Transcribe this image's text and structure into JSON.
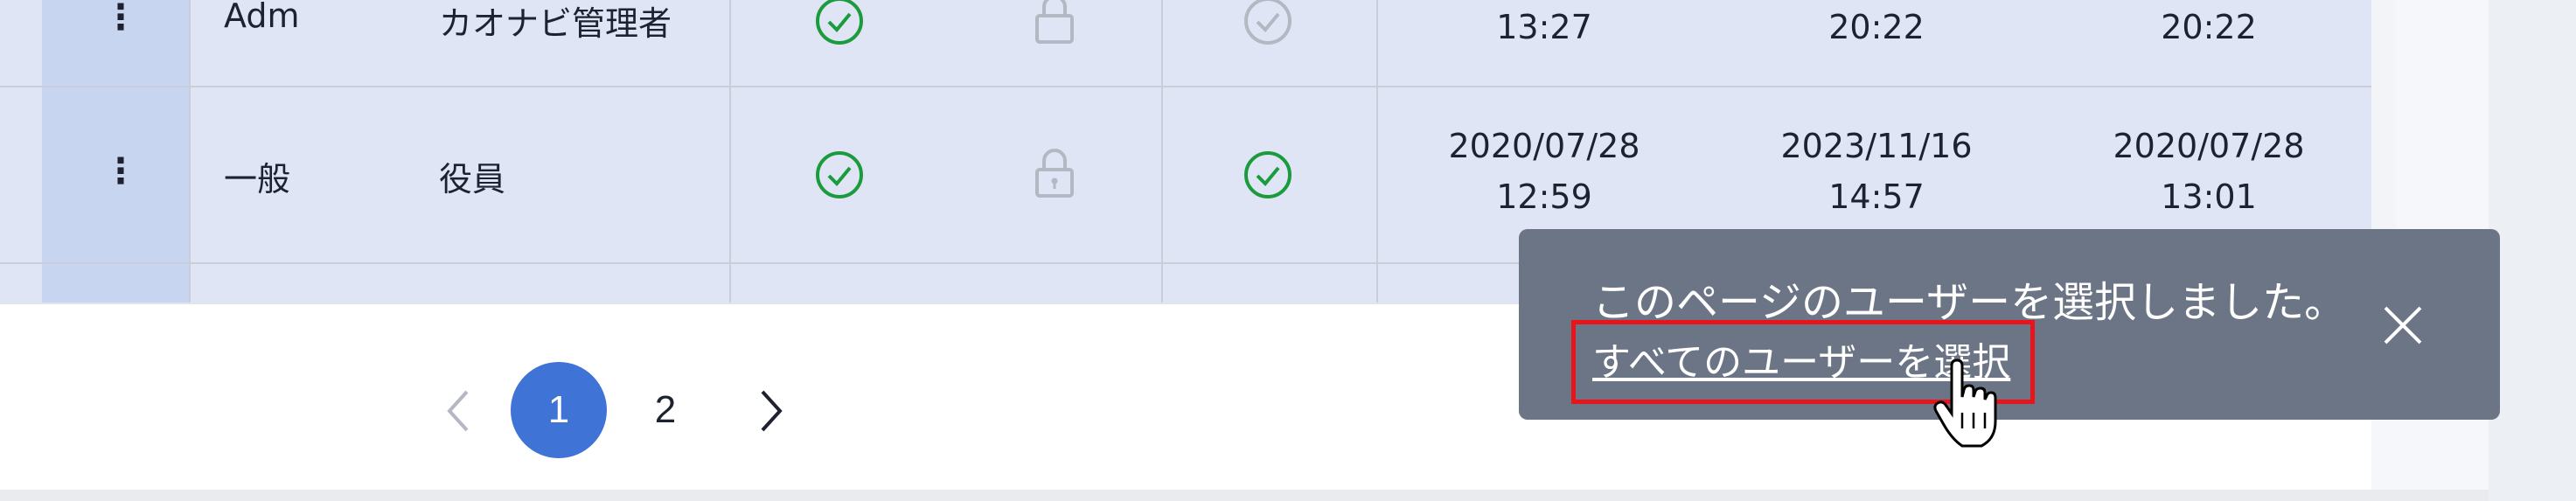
{
  "table": {
    "rows": [
      {
        "menu_icon": "kebab-vertical-icon",
        "type": "Adm",
        "role": "カオナビ管理者",
        "status1": "check-circle-icon",
        "status2": "lock-icon",
        "status3": "check-circle-icon",
        "date1_time": "13:27",
        "date2_time": "20:22",
        "date3_time": "20:22"
      },
      {
        "menu_icon": "kebab-vertical-icon",
        "type": "一般",
        "role": "役員",
        "status1": "check-circle-icon",
        "status2": "lock-icon",
        "status3": "check-circle-icon",
        "date1": "2020/07/28",
        "date1_time": "12:59",
        "date2": "2023/11/16",
        "date2_time": "14:57",
        "date3": "2020/07/28",
        "date3_time": "13:01"
      }
    ]
  },
  "pagination": {
    "pages": [
      "1",
      "2"
    ],
    "current": "1",
    "prev_icon": "chevron-left-icon",
    "next_icon": "chevron-right-icon"
  },
  "toast": {
    "message": "このページのユーザーを選択しました。",
    "link_label": "すべてのユーザーを選択",
    "close_icon": "close-icon",
    "highlight_color": "#e8141a"
  },
  "colors": {
    "accent": "#3f73d6",
    "success": "#1a9b3c",
    "toast_bg": "#6b7585"
  }
}
